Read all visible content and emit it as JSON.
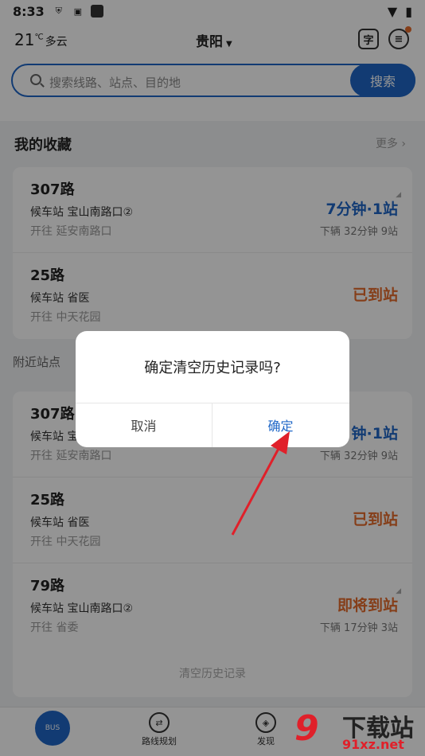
{
  "status": {
    "time": "8:33"
  },
  "header": {
    "temperature": "21",
    "temp_unit": "℃",
    "condition": "多云",
    "city": "贵阳",
    "scan_icon_char": "字"
  },
  "search": {
    "placeholder": "搜索线路、站点、目的地",
    "button": "搜索"
  },
  "favorites": {
    "title": "我的收藏",
    "more": "更多",
    "items": [
      {
        "route": "307路",
        "stop": "候车站 宝山南路口②",
        "direction": "开往 延安南路口",
        "eta": "7分钟·1站",
        "sub": "下辆  32分钟 9站"
      },
      {
        "route": "25路",
        "stop": "候车站 省医",
        "direction": "开往 中天花园",
        "eta": "已到站"
      }
    ]
  },
  "nearby": {
    "title": "附近站点",
    "items": [
      {
        "route": "307路",
        "stop": "候车站 宝",
        "direction": "开往 延安南路口",
        "eta": "钟·1站",
        "sub": "下辆  32分钟 9站"
      },
      {
        "route": "25路",
        "stop": "候车站 省医",
        "direction": "开往 中天花园",
        "eta": "已到站"
      },
      {
        "route": "79路",
        "stop": "候车站 宝山南路口②",
        "direction": "开往 省委",
        "eta": "即将到站",
        "sub": "下辆  17分钟 3站"
      }
    ],
    "clear_history": "清空历史记录"
  },
  "dialog": {
    "title": "确定清空历史记录吗?",
    "cancel": "取消",
    "confirm": "确定"
  },
  "tabs": [
    {
      "label": "",
      "icon_text": "BUS"
    },
    {
      "label": "路线规划"
    },
    {
      "label": "发现"
    }
  ],
  "watermark": {
    "nine": "9",
    "main": "下载站",
    "url": "91xz.net"
  },
  "colors": {
    "accent": "#1f67c7",
    "orange": "#e56b2c",
    "arrow": "#e0202a"
  }
}
